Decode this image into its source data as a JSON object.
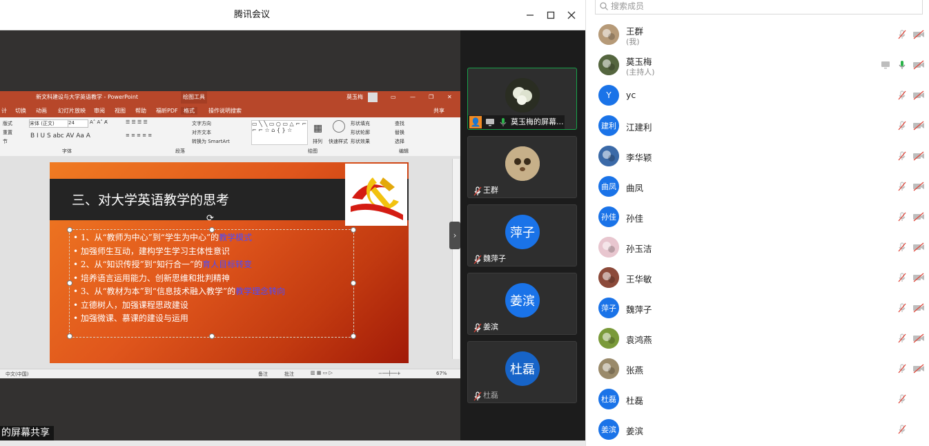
{
  "window": {
    "title": "腾讯会议"
  },
  "share": {
    "tag": "的屏幕共享"
  },
  "ppt": {
    "title": "新文科建设与大学英语教学  -  PowerPoint",
    "context_tab": "绘图工具",
    "user": "莫玉梅",
    "tabs": [
      "计",
      "切换",
      "动画",
      "幻灯片放映",
      "审阅",
      "视图",
      "帮助",
      "福昕PDF",
      "格式",
      "操作说明搜索",
      "共享"
    ],
    "ribbon": {
      "layout": "版式",
      "reset": "重置",
      "section": "节",
      "font_name": "宋体 (正文)",
      "font_size": "24",
      "text_direction": "文字方向",
      "align_text": "对齐文本",
      "smartart": "转换为 SmartArt",
      "arrange": "排列",
      "quick_styles": "快速样式",
      "shape_fill": "形状填充",
      "shape_outline": "形状轮廓",
      "shape_effects": "形状效果",
      "find": "查找",
      "replace": "替换",
      "select": "选择",
      "group_font": "字体",
      "group_paragraph": "段落",
      "group_drawing": "绘图",
      "group_editing": "编辑"
    },
    "status": {
      "lang": "中文(中国)",
      "notes": "备注",
      "comments": "批注",
      "zoom": "67%"
    },
    "slide": {
      "title": "三、对大学英语教学的思考",
      "lines": [
        {
          "pre": "1、从“教师为中心”到“学生为中心”的",
          "hl": "教学模式"
        },
        {
          "pre": "加强师生互动，建构学生学习主体性意识",
          "hl": ""
        },
        {
          "pre": "2、从“知识传授”到“知行合一”的",
          "hl": "育人目标转变"
        },
        {
          "pre": "培养语言运用能力、创新思维和批判精神",
          "hl": ""
        },
        {
          "pre": "3、从“教材为本”到“信息技术融入教学”的",
          "hl": "教学理念转向"
        },
        {
          "pre": "立德树人，加强课程思政建设",
          "hl": ""
        },
        {
          "pre": "加强微课、慕课的建设与运用",
          "hl": ""
        }
      ]
    }
  },
  "tiles": [
    {
      "name": "莫玉梅的屏幕...",
      "avatar_text": "",
      "color": "#2a2a2a"
    },
    {
      "name": "王群",
      "avatar_text": "",
      "color": "#b9a88a"
    },
    {
      "name": "魏萍子",
      "avatar_text": "萍子",
      "color": "#1a73e8"
    },
    {
      "name": "姜滨",
      "avatar_text": "姜滨",
      "color": "#1a73e8"
    },
    {
      "name": "杜磊",
      "avatar_text": "杜磊",
      "color": "#1764c8"
    }
  ],
  "panel": {
    "search_placeholder": "搜索成员",
    "members": [
      {
        "name": "王群",
        "sub": "(我)",
        "avatar": "",
        "color": "#b69a78"
      },
      {
        "name": "莫玉梅",
        "sub": "(主持人)",
        "avatar": "",
        "color": "#55663f"
      },
      {
        "name": "yc",
        "sub": "",
        "avatar": "Y",
        "color": "#1a73e8"
      },
      {
        "name": "江建利",
        "sub": "",
        "avatar": "建利",
        "color": "#1a73e8"
      },
      {
        "name": "李华颖",
        "sub": "",
        "avatar": "",
        "color": "#3b6aa8"
      },
      {
        "name": "曲凤",
        "sub": "",
        "avatar": "曲凤",
        "color": "#1a73e8"
      },
      {
        "name": "孙佳",
        "sub": "",
        "avatar": "孙佳",
        "color": "#1a73e8"
      },
      {
        "name": "孙玉洁",
        "sub": "",
        "avatar": "",
        "color": "#e8c6cf"
      },
      {
        "name": "王华敏",
        "sub": "",
        "avatar": "",
        "color": "#8c4a3a"
      },
      {
        "name": "魏萍子",
        "sub": "",
        "avatar": "萍子",
        "color": "#1a73e8"
      },
      {
        "name": "袁鸿燕",
        "sub": "",
        "avatar": "",
        "color": "#7a9a3a"
      },
      {
        "name": "张燕",
        "sub": "",
        "avatar": "",
        "color": "#9a8a6a"
      },
      {
        "name": "杜磊",
        "sub": "",
        "avatar": "杜磊",
        "color": "#1a73e8"
      },
      {
        "name": "姜滨",
        "sub": "",
        "avatar": "姜滨",
        "color": "#1a73e8"
      }
    ]
  }
}
